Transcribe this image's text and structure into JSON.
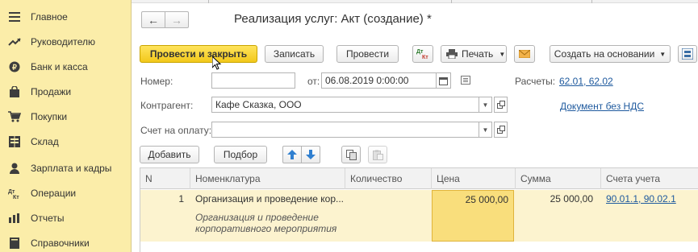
{
  "sidebar": {
    "items": [
      {
        "label": "Главное",
        "icon": "menu-list-icon",
        "glyph": "≣"
      },
      {
        "label": "Руководителю",
        "icon": "trend-icon",
        "glyph": "↗"
      },
      {
        "label": "Банк и касса",
        "icon": "coin-icon",
        "glyph": "●"
      },
      {
        "label": "Продажи",
        "icon": "shopping-bag-icon",
        "glyph": "▮"
      },
      {
        "label": "Покупки",
        "icon": "cart-icon",
        "glyph": "🛒"
      },
      {
        "label": "Склад",
        "icon": "warehouse-icon",
        "glyph": "▦"
      },
      {
        "label": "Зарплата и кадры",
        "icon": "person-icon",
        "glyph": "●"
      },
      {
        "label": "Операции",
        "icon": "dt-kt-icon",
        "glyph": "ᴰᵀₖₜ"
      },
      {
        "label": "Отчеты",
        "icon": "bar-chart-icon",
        "glyph": "▮"
      },
      {
        "label": "Справочники",
        "icon": "book-icon",
        "glyph": "▮"
      }
    ]
  },
  "nav": {
    "back": "←",
    "forward": "→"
  },
  "title": "Реализация услуг: Акт (создание) *",
  "toolbar": {
    "post_close": "Провести и закрыть",
    "save": "Записать",
    "post": "Провести",
    "dtkt": "Дт Кт",
    "print": "Печать",
    "create_based": "Создать на основании"
  },
  "form": {
    "number_label": "Номер:",
    "number_value": "",
    "date_label": "от:",
    "date_value": "06.08.2019  0:00:00",
    "accounts_label": "Расчеты:",
    "accounts_value": "62.01, 62.02",
    "counterparty_label": "Контрагент:",
    "counterparty_value": "Кафе Сказка, ООО",
    "vat_link": "Документ без НДС",
    "invoice_label": "Счет на оплату:",
    "invoice_value": ""
  },
  "table_toolbar": {
    "add": "Добавить",
    "select": "Подбор"
  },
  "table": {
    "columns": [
      "N",
      "Номенклатура",
      "Количество",
      "Цена",
      "Сумма",
      "Счета учета"
    ],
    "rows": [
      {
        "n": "1",
        "item": "Организация и проведение кор...",
        "item_desc_1": "Организация и проведение",
        "item_desc_2": "корпоративного мероприятия",
        "qty": "",
        "price": "25 000,00",
        "sum": "25 000,00",
        "accounts": "90.01.1, 90.02.1"
      }
    ]
  }
}
